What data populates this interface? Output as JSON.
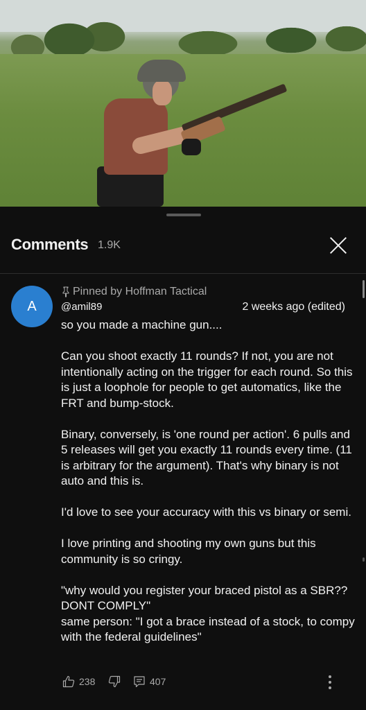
{
  "sheet": {
    "title": "Comments",
    "count": "1.9K"
  },
  "comment": {
    "avatar_letter": "A",
    "avatar_color": "#2a7fd0",
    "pinned_label": "Pinned by Hoffman Tactical",
    "author": "@amil89",
    "time": "2 weeks ago (edited)",
    "paragraphs": [
      "so you made a machine gun....",
      "Can you shoot exactly 11 rounds?  If not, you are not intentionally acting on the trigger for each round.  So this is just a loophole for people to get automatics, like the FRT and bump-stock.",
      "Binary, conversely, is 'one round per action'.  6 pulls and 5 releases will get you exactly 11 rounds every time.  (11 is arbitrary for the argument).  That's why binary is not auto and this is.",
      "I'd love to see your accuracy with this vs binary or semi.",
      "I love printing and shooting my own guns but this community is so cringy.",
      "\"why would you register your braced pistol as a SBR?? DONT COMPLY\"\nsame person: \"I got a brace instead of a stock, to compy with the federal guidelines\""
    ],
    "likes": "238",
    "replies": "407"
  },
  "icons": {
    "close": "close-icon",
    "pin": "pin-icon",
    "like": "thumbs-up-icon",
    "dislike": "thumbs-down-icon",
    "reply": "reply-icon",
    "more": "more-vertical-icon"
  }
}
